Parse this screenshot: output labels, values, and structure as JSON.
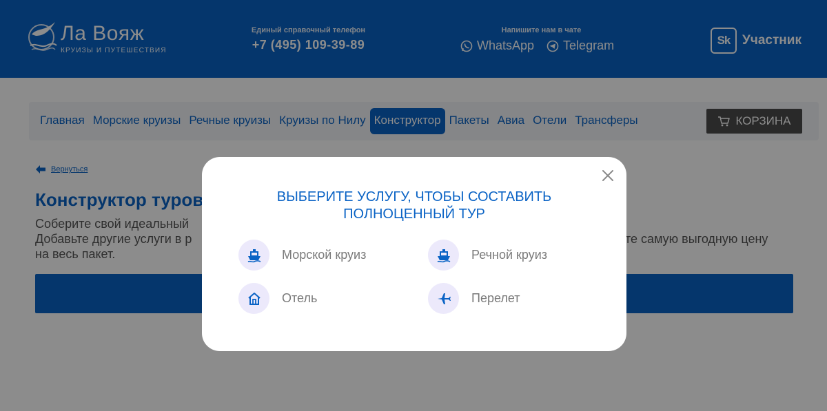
{
  "header": {
    "logo_title": "Ла Вояж",
    "logo_subtitle": "КРУИЗЫ И ПУТЕШЕСТВИЯ",
    "phone_caption": "Единый справочный телефон",
    "phone_number": "+7 (495) 109-39-89",
    "chat_caption": "Напишите нам в чате",
    "whatsapp_label": "WhatsApp",
    "telegram_label": "Telegram",
    "sk_badge": "Sk",
    "sk_label": "Участник"
  },
  "nav": {
    "items": [
      {
        "label": "Главная"
      },
      {
        "label": "Морские круизы"
      },
      {
        "label": "Речные круизы"
      },
      {
        "label": "Круизы по Нилу"
      },
      {
        "label": "Конструктор"
      },
      {
        "label": "Пакеты"
      },
      {
        "label": "Авиа"
      },
      {
        "label": "Отели"
      },
      {
        "label": "Трансферы"
      }
    ],
    "cart_label": "КОРЗИНА"
  },
  "page": {
    "back_label": "Вернуться",
    "title": "Конструктор туров",
    "text_line1_left": "Соберите свой идеальный",
    "text_line2_left": "Добавьте другие услуги в р",
    "text_line2_right": "те самую выгодную цену",
    "text_line3": "на весь пакет."
  },
  "modal": {
    "title_line1": "ВЫБЕРИТЕ УСЛУГУ, ЧТОБЫ СОСТАВИТЬ",
    "title_line2": "ПОЛНОЦЕННЫЙ ТУР",
    "services": [
      {
        "label": "Морской круиз",
        "icon": "ship-icon"
      },
      {
        "label": "Речной круиз",
        "icon": "ship-icon"
      },
      {
        "label": "Отель",
        "icon": "house-icon"
      },
      {
        "label": "Перелет",
        "icon": "plane-icon"
      }
    ]
  },
  "colors": {
    "brand_blue": "#0a63c5",
    "cart_gray": "#4b4b4b",
    "icon_circle": "#ece9fb"
  }
}
